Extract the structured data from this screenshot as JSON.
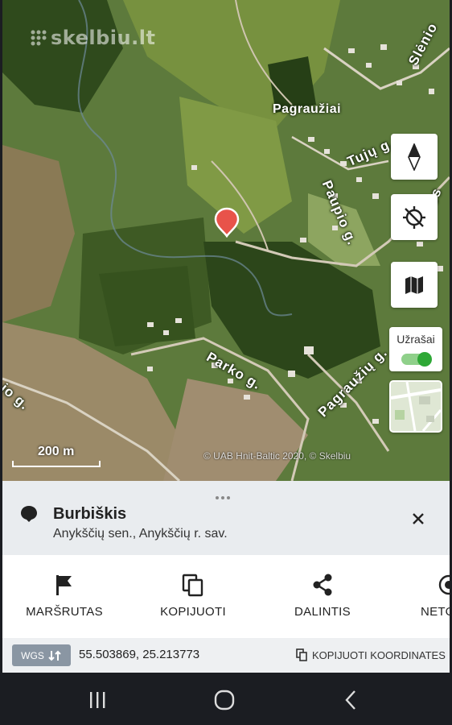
{
  "map": {
    "watermark": "skelbiu.lt",
    "place_label": "Pagraužiai",
    "streets": [
      "Tujų g.",
      "Paupio g.",
      "Parko g.",
      "Pagraužių g.",
      "Slėnio",
      "ios",
      "io g."
    ],
    "scale_label": "200 m",
    "attribution": "© UAB Hnit-Baltic 2020, © Skelbiu",
    "layer_toggle_label": "Užrašai",
    "layer_toggle_on": true,
    "controls": [
      "compass-icon",
      "locate-icon",
      "map-layers-icon"
    ]
  },
  "sheet": {
    "title": "Burbiškis",
    "subtitle": "Anykščių sen., Anykščių r. sav.",
    "actions": [
      {
        "icon": "flag-icon",
        "label": "MARŠRUTAS"
      },
      {
        "icon": "copy-icon",
        "label": "KOPIJUOTI"
      },
      {
        "icon": "share-icon",
        "label": "DALINTIS"
      },
      {
        "icon": "nearby-icon",
        "label": "NETO"
      }
    ],
    "coords": {
      "system": "WGS",
      "value": "55.503869, 25.213773",
      "copy_label": "KOPIJUOTI KOORDINATES"
    }
  },
  "colors": {
    "pin": "#e8534a",
    "toggle_on": "#2ea836"
  }
}
